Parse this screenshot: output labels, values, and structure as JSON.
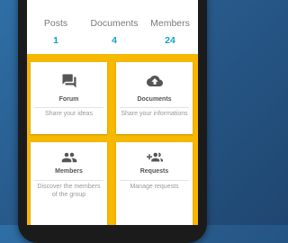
{
  "stats": [
    {
      "label": "Posts",
      "value": "1"
    },
    {
      "label": "Documents",
      "value": "4"
    },
    {
      "label": "Members",
      "value": "24"
    }
  ],
  "tiles": [
    {
      "title": "Forum",
      "description": "Share your ideas",
      "icon": "forum-icon"
    },
    {
      "title": "Documents",
      "description": "Share your informations",
      "icon": "cloud-upload-icon"
    },
    {
      "title": "Members",
      "description": "Discover the members of the group",
      "icon": "group-icon"
    },
    {
      "title": "Requests",
      "description": "Manage requests",
      "icon": "group-add-icon"
    }
  ],
  "colors": {
    "accent": "#13a3c9",
    "grid_background": "#f7b800",
    "tile_background": "#ffffff",
    "page_background": "#2a5f93"
  }
}
